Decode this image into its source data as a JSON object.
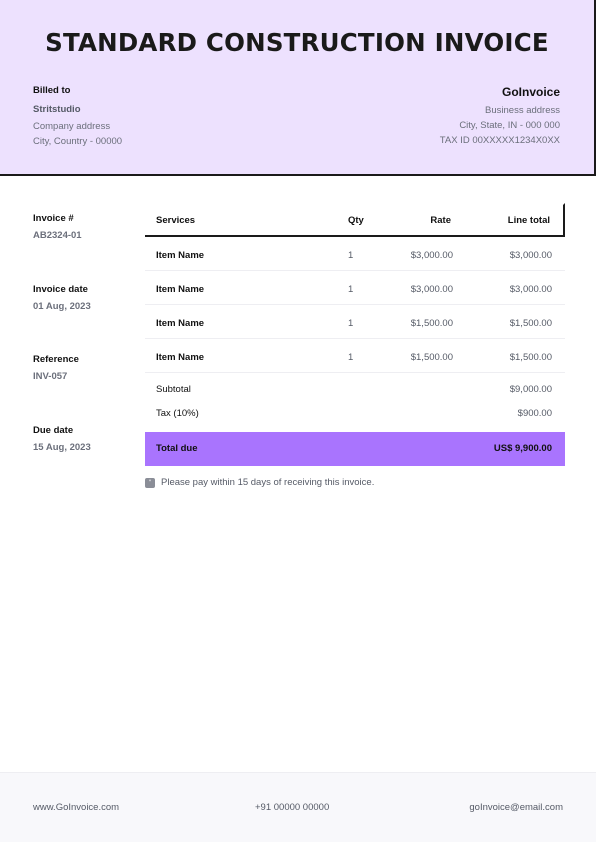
{
  "document": {
    "title": "STANDARD CONSTRUCTION INVOICE"
  },
  "billed_to": {
    "label": "Billed to",
    "name": "Stritstudio",
    "address": "Company address",
    "city": "City, Country - 00000"
  },
  "company": {
    "name": "GoInvoice",
    "address": "Business address",
    "city": "City, State, IN - 000 000",
    "tax_id": "TAX ID 00XXXXX1234X0XX"
  },
  "meta": {
    "invoice_number_label": "Invoice #",
    "invoice_number": "AB2324-01",
    "invoice_date_label": "Invoice date",
    "invoice_date": "01 Aug, 2023",
    "reference_label": "Reference",
    "reference": "INV-057",
    "due_date_label": "Due date",
    "due_date": "15 Aug, 2023"
  },
  "table": {
    "headers": {
      "services": "Services",
      "qty": "Qty",
      "rate": "Rate",
      "line_total": "Line total"
    },
    "rows": [
      {
        "item": "Item Name",
        "qty": "1",
        "rate": "$3,000.00",
        "total": "$3,000.00"
      },
      {
        "item": "Item Name",
        "qty": "1",
        "rate": "$3,000.00",
        "total": "$3,000.00"
      },
      {
        "item": "Item Name",
        "qty": "1",
        "rate": "$1,500.00",
        "total": "$1,500.00"
      },
      {
        "item": "Item Name",
        "qty": "1",
        "rate": "$1,500.00",
        "total": "$1,500.00"
      }
    ],
    "subtotal_label": "Subtotal",
    "subtotal": "$9,000.00",
    "tax_label": "Tax (10%)",
    "tax": "$900.00",
    "total_label": "Total due",
    "total": "US$ 9,900.00"
  },
  "note": {
    "icon": "quote-icon",
    "text": "Please pay within 15 days of receiving this invoice."
  },
  "footer": {
    "website": "www.GoInvoice.com",
    "phone": "+91 00000 00000",
    "email": "goInvoice@email.com"
  },
  "colors": {
    "header_bg": "#ede1fe",
    "total_bg": "#a974fe",
    "footer_bg": "#f8f8fb"
  }
}
